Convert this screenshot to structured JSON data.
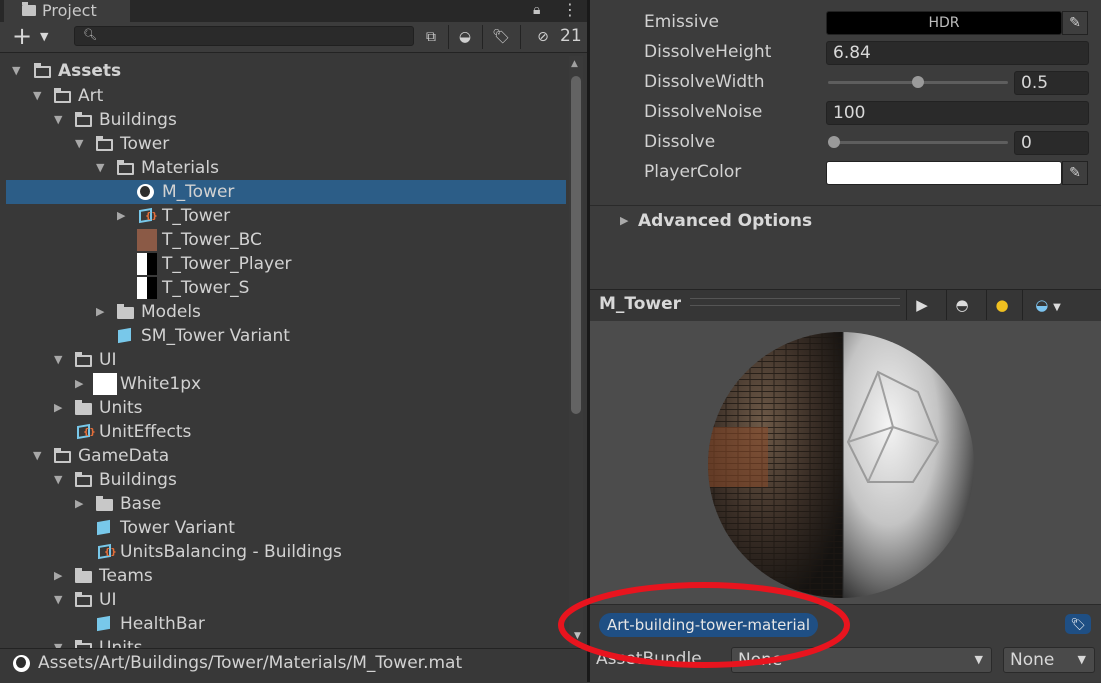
{
  "project_panel": {
    "tab_title": "Project",
    "hidden_count": "21",
    "search": {
      "value": "",
      "placeholder": ""
    },
    "tree": [
      {
        "label": "Assets",
        "bold": true
      },
      {
        "label": "Art"
      },
      {
        "label": "Buildings"
      },
      {
        "label": "Tower"
      },
      {
        "label": "Materials"
      },
      {
        "label": "M_Tower",
        "selected": true
      },
      {
        "label": "T_Tower"
      },
      {
        "label": "T_Tower_BC"
      },
      {
        "label": "T_Tower_Player"
      },
      {
        "label": "T_Tower_S"
      },
      {
        "label": "Models"
      },
      {
        "label": "SM_Tower Variant"
      },
      {
        "label": "UI"
      },
      {
        "label": "White1px"
      },
      {
        "label": "Units"
      },
      {
        "label": "UnitEffects"
      },
      {
        "label": "GameData"
      },
      {
        "label": "Buildings"
      },
      {
        "label": "Base"
      },
      {
        "label": "Tower Variant"
      },
      {
        "label": "UnitsBalancing - Buildings"
      },
      {
        "label": "Teams"
      },
      {
        "label": "UI"
      },
      {
        "label": "HealthBar"
      },
      {
        "label": "Units"
      }
    ],
    "status_path": "Assets/Art/Buildings/Tower/Materials/M_Tower.mat"
  },
  "inspector": {
    "properties": [
      {
        "label": "Emissive",
        "value": "HDR"
      },
      {
        "label": "DissolveHeight",
        "value": "6.84"
      },
      {
        "label": "DissolveWidth",
        "value": "0.5",
        "slider_fraction": 0.5
      },
      {
        "label": "DissolveNoise",
        "value": "100"
      },
      {
        "label": "Dissolve",
        "value": "0",
        "slider_fraction": 0.0
      },
      {
        "label": "PlayerColor",
        "value": ""
      }
    ],
    "player_color": "#ffffff",
    "emissive_color": "#000000",
    "advanced_options": "Advanced Options",
    "preview_title": "M_Tower",
    "asset_label": "Art-building-tower-material",
    "asset_bundle_label": "AssetBundle",
    "asset_bundle_value": "None",
    "asset_bundle_variant": "None"
  },
  "colors": {
    "selection": "#2c5d87",
    "label_chip": "#1f4f84",
    "annotation": "#e8141e",
    "asset_icon": "#78c8ea"
  }
}
